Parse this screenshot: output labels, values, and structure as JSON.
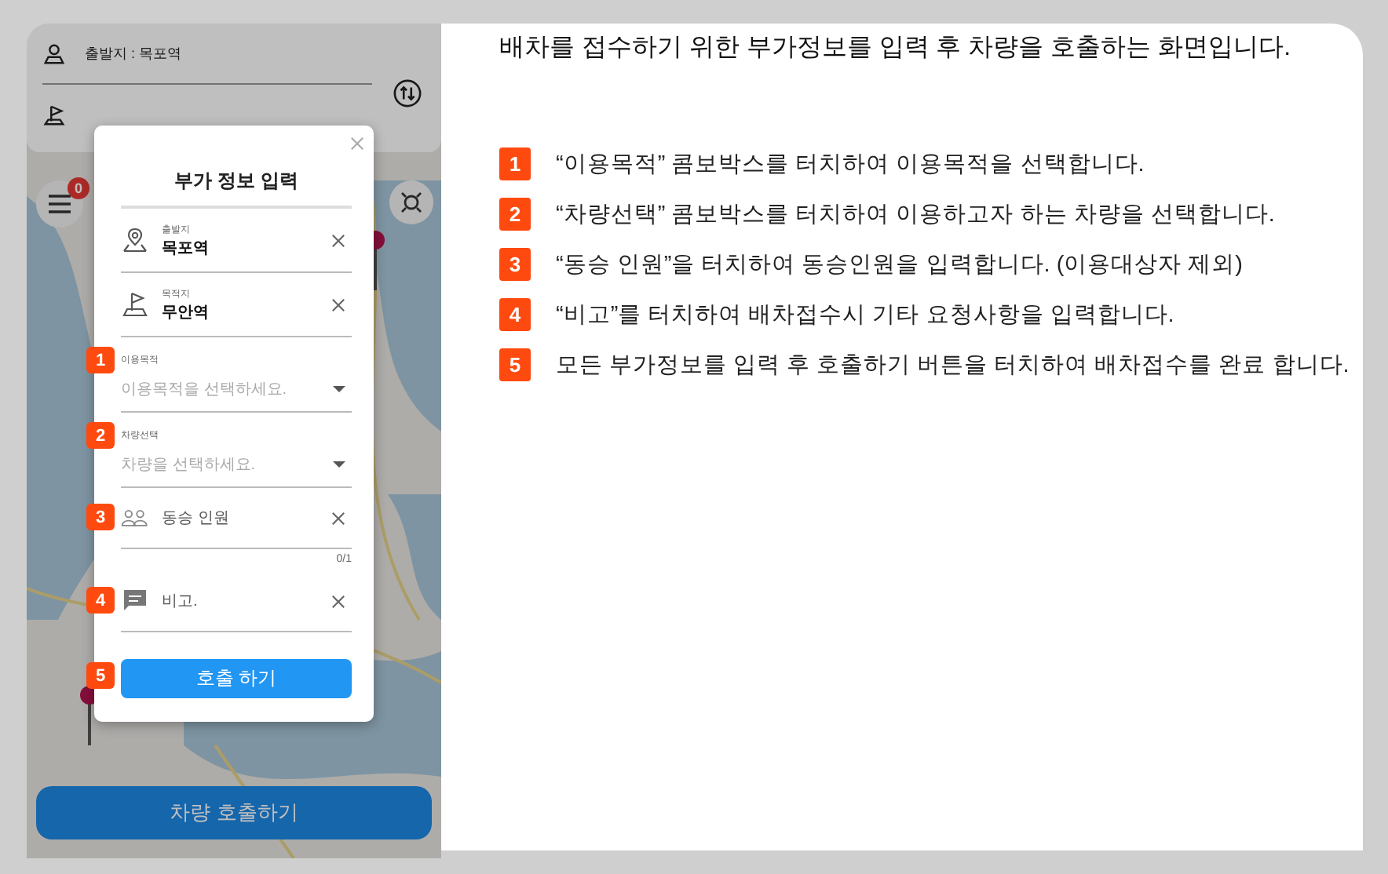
{
  "phone": {
    "header": {
      "origin": "출발지 : 목포역"
    },
    "menu_badge": "0",
    "bottom_button": "차량 호출하기"
  },
  "modal": {
    "title": "부가 정보 입력",
    "fields": [
      {
        "kind": "origin",
        "label": "출발지",
        "value": "목포역"
      },
      {
        "kind": "destination",
        "label": "목적지",
        "value": "무안역"
      },
      {
        "kind": "select",
        "marker": "1",
        "label": "이용목적",
        "placeholder": "이용목적을 선택하세요."
      },
      {
        "kind": "select",
        "marker": "2",
        "label": "차량선택",
        "placeholder": "차량을 선택하세요."
      },
      {
        "kind": "count",
        "marker": "3",
        "placeholder": "동승 인원",
        "counter": "0/1"
      },
      {
        "kind": "note",
        "marker": "4",
        "placeholder": "비고."
      }
    ],
    "button": {
      "label": "호출 하기",
      "marker": "5"
    }
  },
  "instructions": {
    "title": "배차를 접수하기 위한 부가정보를 입력 후 차량을 호출하는 화면입니다.",
    "steps": [
      {
        "number": "1",
        "text": "“이용목적” 콤보박스를 터치하여 이용목적을 선택합니다."
      },
      {
        "number": "2",
        "text": "“차량선택” 콤보박스를 터치하여 이용하고자 하는 차량을 선택합니다."
      },
      {
        "number": "3",
        "text": "“동승 인원”을 터치하여 동승인원을 입력합니다. (이용대상자 제외)"
      },
      {
        "number": "4",
        "text": "“비고”를 터치하여 배차접수시 기타 요청사항을 입력합니다."
      },
      {
        "number": "5",
        "text": "모든 부가정보를 입력 후 호출하기 버튼을 터치하여 배차접수를 완료 합니다."
      }
    ]
  }
}
